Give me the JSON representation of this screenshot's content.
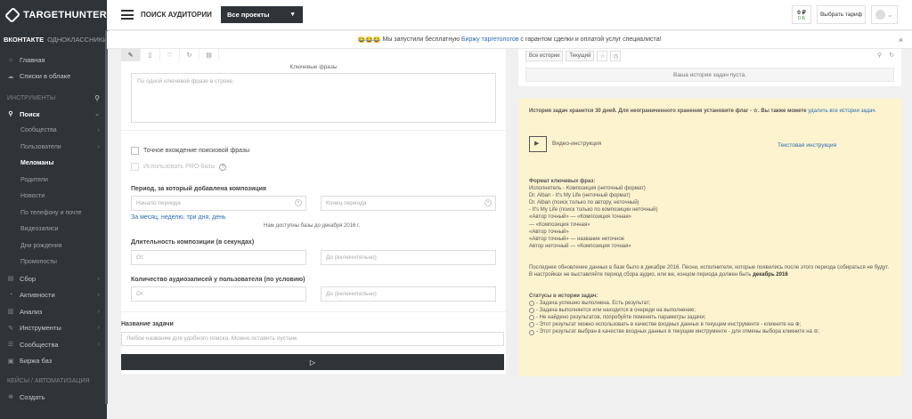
{
  "sidebar": {
    "logo": "TARGETHUNTER",
    "networks": [
      "ВКОНТАКТЕ",
      "ОДНОКЛАССНИКИ"
    ],
    "top_items": [
      {
        "label": "Главная",
        "icon": "home-icon"
      },
      {
        "label": "Списки в облаке",
        "icon": "cloud-icon"
      }
    ],
    "tools_section": "ИНСТРУМЕНТЫ",
    "search_label": "Поиск",
    "search_subitems": [
      {
        "label": "Сообщества",
        "chevron": true
      },
      {
        "label": "Пользователи",
        "chevron": true
      },
      {
        "label": "Меломаны",
        "active": true
      },
      {
        "label": "Родители"
      },
      {
        "label": "Новости"
      },
      {
        "label": "По телефону и почте"
      },
      {
        "label": "Видеозаписи"
      },
      {
        "label": "Дни рождения"
      },
      {
        "label": "Промопосты"
      }
    ],
    "groups": [
      {
        "label": "Сбор",
        "icon": "collect-icon"
      },
      {
        "label": "Активности",
        "icon": "activity-icon"
      },
      {
        "label": "Анализ",
        "icon": "analysis-icon"
      },
      {
        "label": "Инструменты",
        "icon": "tools-icon"
      },
      {
        "label": "Сообщества",
        "icon": "community-icon"
      },
      {
        "label": "Биржа баз",
        "icon": "exchange-icon"
      }
    ],
    "cases_section": "КЕЙСЫ / АВТОМАТИЗАЦИЯ",
    "create_label": "Создать"
  },
  "header": {
    "title": "ПОИСК АУДИТОРИИ",
    "projects": "Все проекты",
    "balance": "0 ₽",
    "balance_bonus": "0 Б",
    "tariff": "Выбрать тариф"
  },
  "announcement": {
    "emoji": "😂😂😂",
    "before": " Мы запустили бесплатную ",
    "link": "Биржу таргетологов",
    "after": " с гарантом сделки и оплатой услуг специалиста!"
  },
  "form": {
    "keywords_label": "Ключевые фразы",
    "keywords_placeholder": "По одной ключевой фразе в строке.",
    "exact_match": "Точное вхождение поисковой фразы",
    "pro_base": "Использовать PRO-базы",
    "period_label": "Период, за который добавлена композиция",
    "period_start": "Начало периода",
    "period_end": "Конец периода",
    "quick_periods": "За месяц, неделю, три дня, день",
    "base_note": "Нам доступны базы до декабря 2016 г.",
    "duration_label": "Длительность композиции (в секундах)",
    "from": "От",
    "to": "До (включительно)",
    "count_label": "Количество аудиозаписей у пользователя (по условию)",
    "task_name_label": "Название задачи",
    "task_name_placeholder": "Любое название для удобного поиска. Можно оставить пустым.",
    "run_icon": "▷"
  },
  "history": {
    "tab_all": "Все истории",
    "tab_current": "Текущий",
    "empty": "Ваша история задач пуста."
  },
  "info": {
    "store_text": "История задач хранится 30 дней. Для неограниченного хранения установите флаг - ☆. Вы также можете ",
    "store_link": "удалить все истории задач.",
    "video": "Видео-инструкция",
    "text_instr": "Текстовая инструкция",
    "format_title": "Формат ключевых фраз:",
    "format_lines": [
      "Исполнитель - Композиция (неточный формат)",
      "Dr. Alban - It's My Life (неточный формат)",
      "Dr. Alban (поиск только по автору, неточный)",
      "- It's My Life (поиск только по композиции неточный)",
      "«Автор точный» — «Композиция точная»",
      "— «Композиция точная»",
      "«Автор точный»",
      "«Автор точный» — название неточное",
      "Автор неточный — «Композиция точная»"
    ],
    "update_text": "Последнее обновление данных в базе было в декабре 2016. Песни, исполнители, которые появились после этого периода собираться не будут. В настройках не выставляйте период сбора аудио, или же, концом периода должен быть ",
    "update_bold": "декабрь 2016",
    "statuses_title": "Статусы в истории задач:",
    "statuses": [
      "- Задача успешно выполнена. Есть результат;",
      "- Задача выполняется или находится в очереди на выполнение;",
      "- Не найдено результатов, попробуйте поменять параметры задачи;",
      "- Этот результат можно использовать в качестве входных данных в текущем инструменте - кликните на ⊕;",
      "- Этот результат выбран в качестве входных данных в текущем инструменте - для отмены выбора кликните на ⊖;"
    ]
  }
}
